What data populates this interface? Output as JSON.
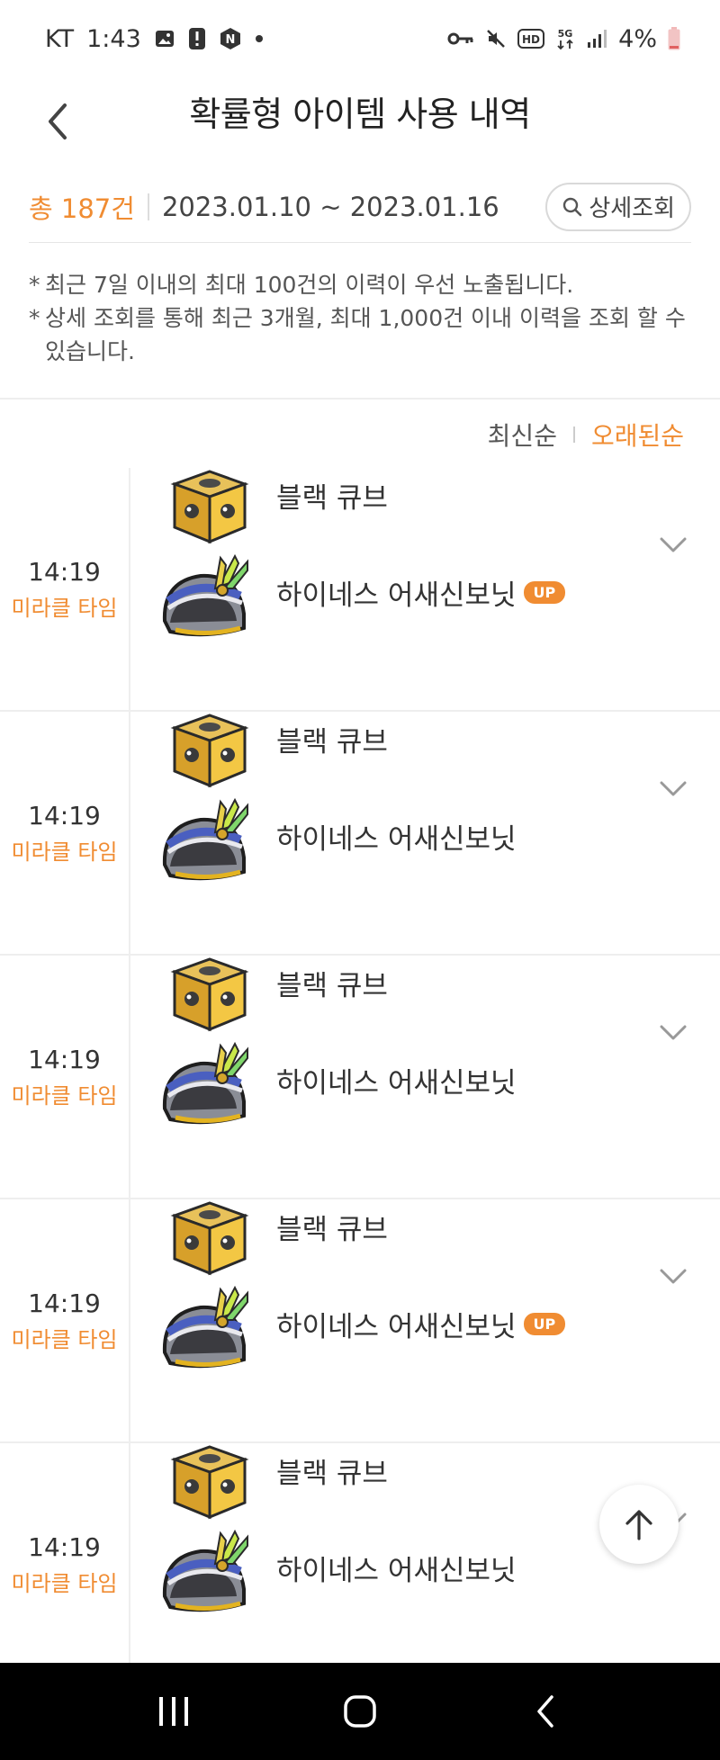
{
  "status_bar": {
    "carrier": "KT",
    "time": "1:43",
    "battery": "4%"
  },
  "header": {
    "title": "확률형 아이템 사용 내역"
  },
  "summary": {
    "total": "총 187건",
    "date_range": "2023.01.10 ~ 2023.01.16",
    "detail_button": "상세조회"
  },
  "notes": [
    "최근 7일 이내의 최대 100건의 이력이 우선 노출됩니다.",
    "상세 조회를 통해 최근 3개월, 최대 1,000건 이내 이력을 조회 할 수 있습니다."
  ],
  "sort": {
    "latest": "최신순",
    "oldest": "오래된순"
  },
  "records": [
    {
      "time": "14:19",
      "tag": "미라클 타임",
      "cube": "블랙 큐브",
      "item": "하이네스 어새신보닛",
      "badge": "UP"
    },
    {
      "time": "14:19",
      "tag": "미라클 타임",
      "cube": "블랙 큐브",
      "item": "하이네스 어새신보닛",
      "badge": ""
    },
    {
      "time": "14:19",
      "tag": "미라클 타임",
      "cube": "블랙 큐브",
      "item": "하이네스 어새신보닛",
      "badge": ""
    },
    {
      "time": "14:19",
      "tag": "미라클 타임",
      "cube": "블랙 큐브",
      "item": "하이네스 어새신보닛",
      "badge": "UP"
    },
    {
      "time": "14:19",
      "tag": "미라클 타임",
      "cube": "블랙 큐브",
      "item": "하이네스 어새신보닛",
      "badge": ""
    }
  ],
  "colors": {
    "accent": "#f08c32",
    "text": "#333333",
    "divider": "#eeeeee"
  }
}
